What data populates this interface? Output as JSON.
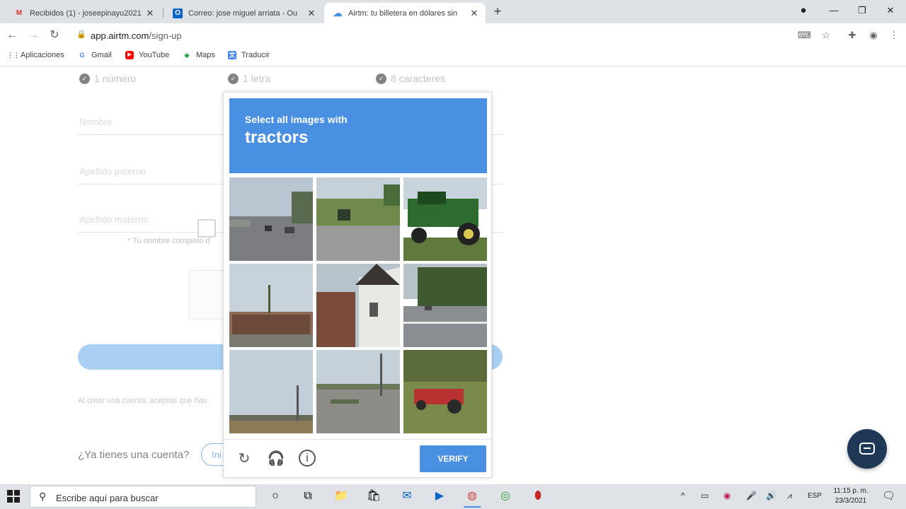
{
  "browser": {
    "tabs": [
      {
        "title": "Recibidos (1) - joseepinayu2021",
        "favicon": "gmail-icon",
        "active": false
      },
      {
        "title": "Correo: jose miguel arriata - Ou",
        "favicon": "outlook-icon",
        "active": false
      },
      {
        "title": "Airtm: tu billetera en dólares sin",
        "favicon": "airtm-icon",
        "active": true
      }
    ],
    "new_tab": "+",
    "url_host": "app.airtm.com",
    "url_path": "/sign-up",
    "bookmarks": [
      {
        "label": "Aplicaciones",
        "icon": "apps-grid-icon"
      },
      {
        "label": "Gmail",
        "icon": "google-icon"
      },
      {
        "label": "YouTube",
        "icon": "youtube-icon"
      },
      {
        "label": "Maps",
        "icon": "maps-icon"
      },
      {
        "label": "Traducir",
        "icon": "translate-icon"
      }
    ]
  },
  "signup": {
    "requirements": [
      "1 número",
      "1 letra",
      "8 caracteres"
    ],
    "fields": [
      "Nombre",
      "Apellido paterno",
      "Apellido materno"
    ],
    "note": "* Tu nombre completo d",
    "terms": "Al crear una cuenta, aceptas que has",
    "have_account": "¿Ya tienes una cuenta?",
    "login_label": "Ini"
  },
  "captcha": {
    "instruction": "Select all images with",
    "target": "tractors",
    "verify_label": "VERIFY",
    "footer_icons": [
      "reload-icon",
      "audio-icon",
      "info-icon"
    ]
  },
  "taskbar": {
    "search_placeholder": "Escribe aquí para buscar",
    "language": "ESP",
    "time": "11:15 p. m.",
    "date": "23/3/2021"
  },
  "colors": {
    "captcha_blue": "#4a90e2",
    "signup_button": "#7cb5ec",
    "chat_bubble": "#1f3856"
  }
}
